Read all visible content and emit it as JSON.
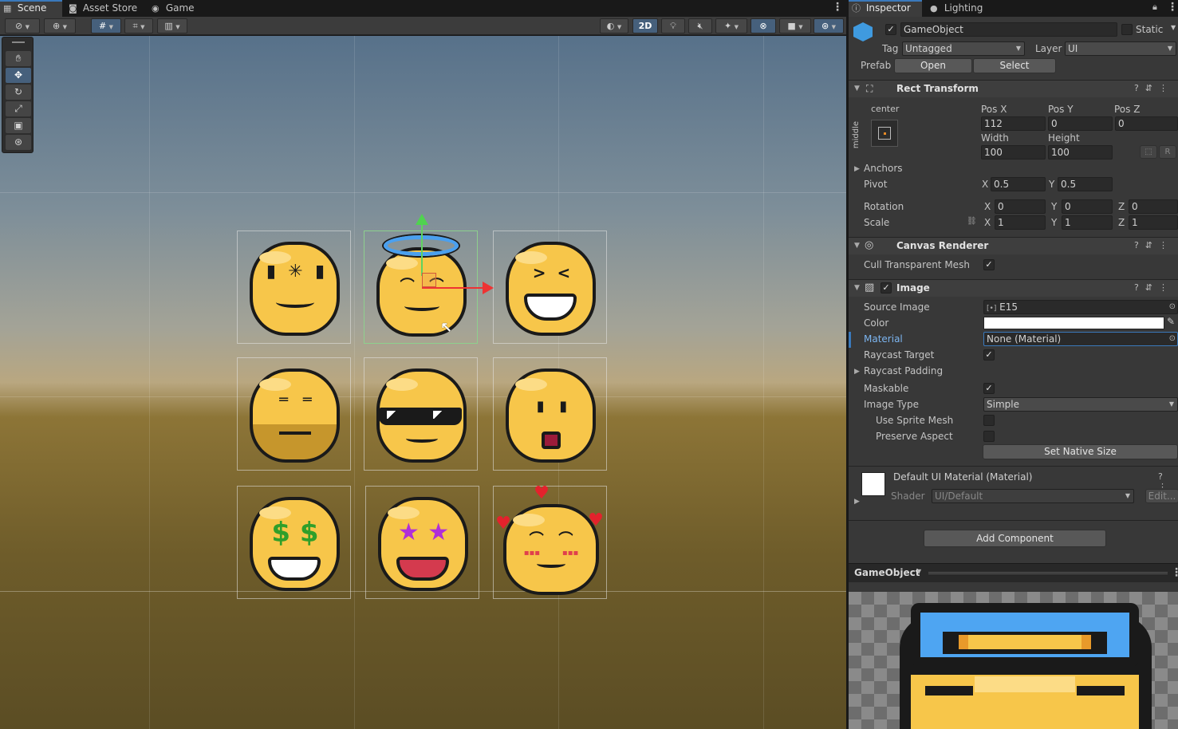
{
  "scene_tabs": [
    {
      "label": "Scene",
      "icon": "grid-icon"
    },
    {
      "label": "Asset Store",
      "icon": "bag-icon"
    },
    {
      "label": "Game",
      "icon": "gamepad-icon"
    }
  ],
  "scene_toolbar": {
    "mode_2d": "2D"
  },
  "tools": [
    "hand-tool",
    "move-tool",
    "rotate-tool",
    "scale-tool",
    "rect-tool",
    "transform-tool"
  ],
  "grid_sprites": [
    {
      "name": "dizzy-face"
    },
    {
      "name": "angel-face"
    },
    {
      "name": "laughing-face"
    },
    {
      "name": "worried-face"
    },
    {
      "name": "sunglasses-face"
    },
    {
      "name": "surprised-face"
    },
    {
      "name": "money-eyes-face"
    },
    {
      "name": "star-eyes-face"
    },
    {
      "name": "love-hearts-face"
    }
  ],
  "inspector": {
    "tabs": [
      {
        "label": "Inspector"
      },
      {
        "label": "Lighting"
      }
    ],
    "gameobject_name": "GameObject",
    "static_label": "Static",
    "tag_label": "Tag",
    "tag_value": "Untagged",
    "layer_label": "Layer",
    "layer_value": "UI",
    "prefab_label": "Prefab",
    "prefab_open": "Open",
    "prefab_select": "Select",
    "rect_transform": {
      "title": "Rect Transform",
      "anchor_h": "center",
      "anchor_v": "middle",
      "pos_x_label": "Pos X",
      "pos_x": "112",
      "pos_y_label": "Pos Y",
      "pos_y": "0",
      "pos_z_label": "Pos Z",
      "pos_z": "0",
      "width_label": "Width",
      "width": "100",
      "height_label": "Height",
      "height": "100",
      "r_button": "R",
      "anchors_label": "Anchors",
      "pivot_label": "Pivot",
      "pivot_x": "0.5",
      "pivot_y": "0.5",
      "rotation_label": "Rotation",
      "rot_x": "0",
      "rot_y": "0",
      "rot_z": "0",
      "scale_label": "Scale",
      "scale_x": "1",
      "scale_y": "1",
      "scale_z": "1",
      "x": "X",
      "y": "Y",
      "z": "Z"
    },
    "canvas_renderer": {
      "title": "Canvas Renderer",
      "cull_label": "Cull Transparent Mesh",
      "cull_checked": true
    },
    "image": {
      "title": "Image",
      "source_image_label": "Source Image",
      "source_image": "E15",
      "color_label": "Color",
      "color_value": "#ffffff",
      "material_label": "Material",
      "material": "None (Material)",
      "raycast_target_label": "Raycast Target",
      "raycast_padding_label": "Raycast Padding",
      "maskable_label": "Maskable",
      "image_type_label": "Image Type",
      "image_type": "Simple",
      "use_sprite_mesh_label": "Use Sprite Mesh",
      "preserve_aspect_label": "Preserve Aspect",
      "set_native_size": "Set Native Size"
    },
    "material_section": {
      "title": "Default UI Material (Material)",
      "shader_label": "Shader",
      "shader_value": "UI/Default",
      "edit_button": "Edit..."
    },
    "add_component": "Add Component",
    "preview_title": "GameObject"
  },
  "colors": {
    "accent": "#3a79bb",
    "selected_label": "#7cb5f0",
    "face_yellow": "#f7c64a"
  }
}
